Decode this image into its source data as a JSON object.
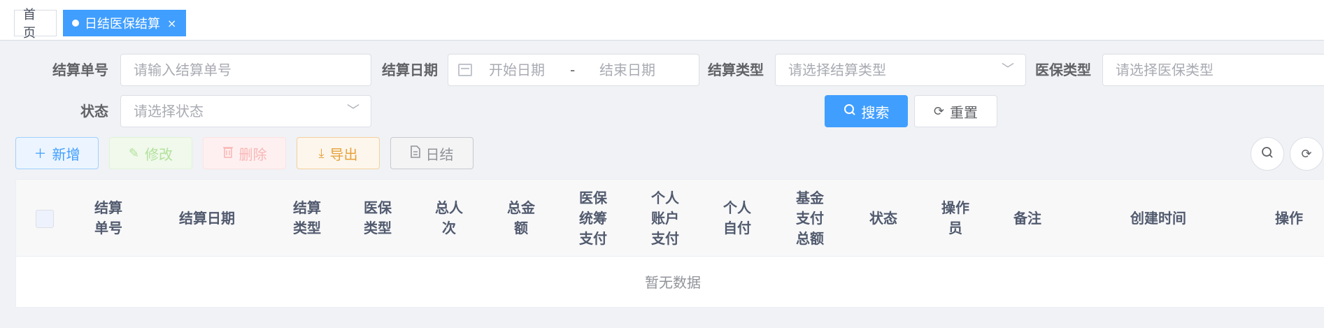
{
  "tags": {
    "home": "首页",
    "active": "日结医保结算",
    "close": "×"
  },
  "form": {
    "settle_no": {
      "label": "结算单号",
      "placeholder": "请输入结算单号"
    },
    "settle_date": {
      "label": "结算日期",
      "start": "开始日期",
      "separator": "-",
      "end": "结束日期"
    },
    "settle_type": {
      "label": "结算类型",
      "placeholder": "请选择结算类型"
    },
    "insurance_type": {
      "label": "医保类型",
      "placeholder": "请选择医保类型"
    },
    "status": {
      "label": "状态",
      "placeholder": "请选择状态"
    },
    "search_label": "搜索",
    "reset_label": "重置"
  },
  "toolbar": {
    "add": "新增",
    "edit": "修改",
    "delete": "删除",
    "export": "导出",
    "daily": "日结"
  },
  "table": {
    "columns": [
      [
        "结算",
        "单号"
      ],
      [
        "结算日期"
      ],
      [
        "结算",
        "类型"
      ],
      [
        "医保",
        "类型"
      ],
      [
        "总人",
        "次"
      ],
      [
        "总金",
        "额"
      ],
      [
        "医保",
        "统筹",
        "支付"
      ],
      [
        "个人",
        "账户",
        "支付"
      ],
      [
        "个人",
        "自付"
      ],
      [
        "基金",
        "支付",
        "总额"
      ],
      [
        "状态"
      ],
      [
        "操作",
        "员"
      ],
      [
        "备注"
      ],
      [
        "创建时间"
      ],
      [
        "操作"
      ]
    ],
    "empty_text": "暂无数据"
  },
  "icons": {
    "chevron": "chevron-down-icon",
    "search": "search-icon",
    "refresh": "refresh-icon"
  },
  "colors": {
    "primary": "#409eff",
    "success": "#67c23a",
    "danger": "#f56c6c",
    "warning": "#e6a23c",
    "info": "#909399"
  }
}
